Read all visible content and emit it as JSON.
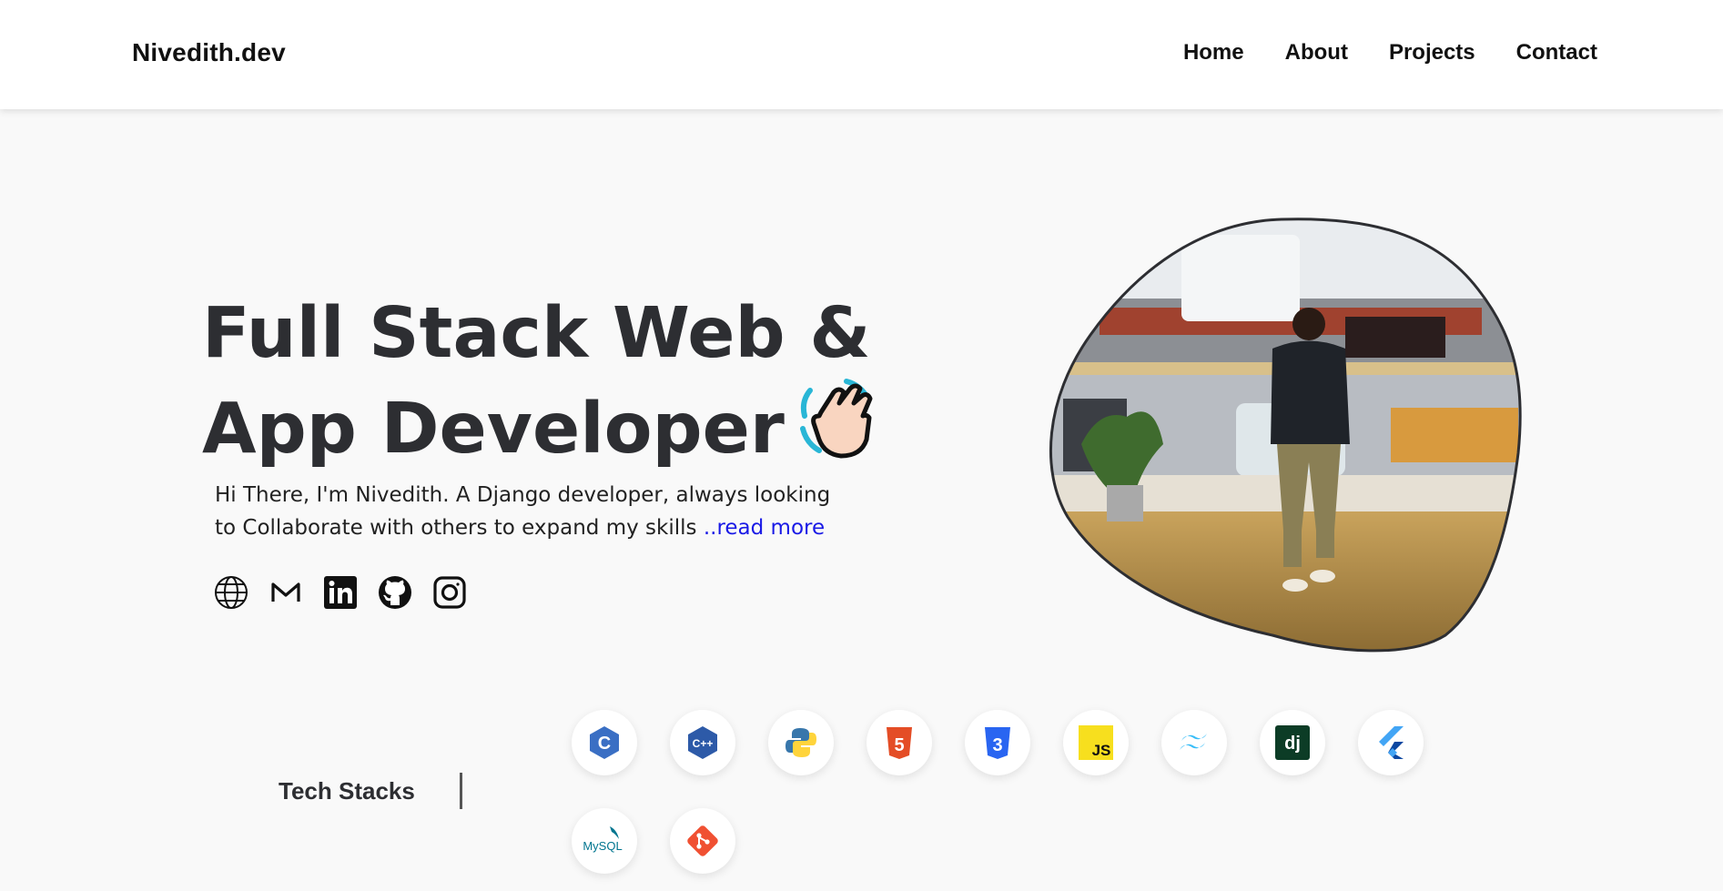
{
  "brand": {
    "logo_text": "Nivedith.dev"
  },
  "nav": {
    "items": [
      {
        "label": "Home"
      },
      {
        "label": "About"
      },
      {
        "label": "Projects"
      },
      {
        "label": "Contact"
      }
    ]
  },
  "hero": {
    "title_line1": "Full Stack Web &",
    "title_line2": "App Developer",
    "description": "Hi There, I'm Nivedith. A Django developer, always looking to Collaborate with others to expand my skills ",
    "read_more": "..read more"
  },
  "socials": [
    {
      "icon": "globe-icon"
    },
    {
      "icon": "gmail-icon"
    },
    {
      "icon": "linkedin-icon"
    },
    {
      "icon": "github-icon"
    },
    {
      "icon": "instagram-icon"
    }
  ],
  "tech": {
    "label": "Tech Stacks",
    "items": [
      {
        "icon": "c-icon",
        "text": "C",
        "color": "#3a6fc4"
      },
      {
        "icon": "cpp-icon",
        "text": "C++",
        "color": "#2d5aa8"
      },
      {
        "icon": "python-icon",
        "text": "",
        "color": "#3776ab"
      },
      {
        "icon": "html5-icon",
        "text": "5",
        "color": "#e44d26"
      },
      {
        "icon": "css3-icon",
        "text": "3",
        "color": "#2965f1"
      },
      {
        "icon": "javascript-icon",
        "text": "JS",
        "color": "#f7df1e"
      },
      {
        "icon": "tailwind-icon",
        "text": "",
        "color": "#38bdf8"
      },
      {
        "icon": "django-icon",
        "text": "dj",
        "color": "#0c3c26"
      },
      {
        "icon": "flutter-icon",
        "text": "",
        "color": "#42a5f5"
      },
      {
        "icon": "mysql-icon",
        "text": "MySQL",
        "color": "#00758f"
      },
      {
        "icon": "git-icon",
        "text": "",
        "color": "#f05032"
      }
    ]
  },
  "colors": {
    "heading": "#2d2e32",
    "link": "#1a1ae6",
    "background": "#f9f9f9"
  }
}
